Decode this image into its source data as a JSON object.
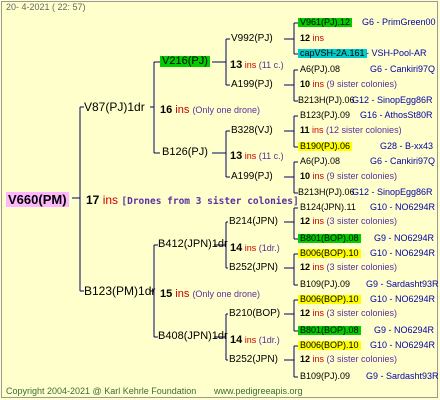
{
  "date": "20-  4-2021  ( 22: 57)",
  "footer": {
    "copyright": "Copyright 2004-2021 @ Karl Kehrle Foundation",
    "site": "www.pedigreeapis.org"
  },
  "colors": {
    "background": "#ffffcc",
    "lines": "#000066",
    "root_bg": "#ffb6ff",
    "green_bg": "#00cc00",
    "cyan_bg": "#00cccc",
    "yellow_bg": "#ffff00",
    "ins": "#cc0000",
    "note": "#5a2fa0",
    "info": "#0000aa"
  },
  "root": {
    "name": "V660(PM)",
    "count": "17",
    "ins": " ins ",
    "note": "[Drones from 3 sister colonies]"
  },
  "gen1": [
    {
      "name": "V87(PJ)1dr",
      "count": "16",
      "ins": " ins ",
      "note": " (Only one drone)"
    },
    {
      "name": "B123(PM)1dr",
      "count": "15",
      "ins": " ins ",
      "note": " (Only one drone)"
    }
  ],
  "gen2": [
    {
      "name": "V216(PJ)",
      "count": "13",
      "ins": " ins ",
      "note": " (11 c.)"
    },
    {
      "name": "B126(PJ)",
      "count": "13",
      "ins": " ins ",
      "note": " (11 c.)"
    },
    {
      "name": "B412(JPN)1dr",
      "count": "14",
      "ins": " ins ",
      "note": " (1dr.)"
    },
    {
      "name": "B408(JPN)1dr",
      "count": "14",
      "ins": " ins ",
      "note": " (1dr.)"
    }
  ],
  "gen3": [
    {
      "name": "V992(PJ)",
      "count": "12",
      "ins": " ins",
      "note": ""
    },
    {
      "name": "A199(PJ)",
      "count": "10",
      "ins": " ins ",
      "note": "(9 sister colonies)"
    },
    {
      "name": "B328(VJ)",
      "count": "11",
      "ins": " ins ",
      "note": "(12 sister colonies)"
    },
    {
      "name": "A199(PJ)",
      "count": "10",
      "ins": " ins ",
      "note": "(9 sister colonies)"
    },
    {
      "name": "B214(JPN)",
      "count": "12",
      "ins": " ins ",
      "note": "(3 sister colonies)"
    },
    {
      "name": "B252(JPN)",
      "count": "12",
      "ins": " ins ",
      "note": "(3 sister colonies)"
    },
    {
      "name": "B210(BOP)",
      "count": "12",
      "ins": " ins ",
      "note": "(3 sister colonies)"
    },
    {
      "name": "B252(JPN)",
      "count": "12",
      "ins": " ins ",
      "note": "(3 sister colonies)"
    }
  ],
  "gen4": [
    {
      "name": "V961(PJ).12",
      "info": "G6 - PrimGreen00"
    },
    {
      "name": "capVSH-2A.161",
      "info": " - VSH-Pool-AR"
    },
    {
      "name": "A6(PJ).08",
      "info": "G6 - Cankiri97Q"
    },
    {
      "name": "B213H(PJ).06",
      "info": "G12 - SinopEgg86R"
    },
    {
      "name": "B123(PJ).09",
      "info": "G16 - AthosSt80R"
    },
    {
      "name": "B190(PJ).06",
      "info": "G28 - B-xx43"
    },
    {
      "name": "A6(PJ).08",
      "info": "G6 - Cankiri97Q"
    },
    {
      "name": "B213H(PJ).06",
      "info": "G12 - SinopEgg86R"
    },
    {
      "name": "B124(JPN).11",
      "info": "G10 - NO6294R"
    },
    {
      "name": "B801(BOP).08",
      "info": "G9 - NO6294R"
    },
    {
      "name": "B006(BOP).10",
      "info": "G10 - NO6294R"
    },
    {
      "name": "B109(PJ).09",
      "info": "G9 - Sardasht93R"
    },
    {
      "name": "B006(BOP).10",
      "info": "G10 - NO6294R"
    },
    {
      "name": "B801(BOP).08",
      "info": "G9 - NO6294R"
    },
    {
      "name": "B006(BOP).10",
      "info": "G10 - NO6294R"
    },
    {
      "name": "B109(PJ).09",
      "info": "G9 - Sardasht93R"
    }
  ]
}
